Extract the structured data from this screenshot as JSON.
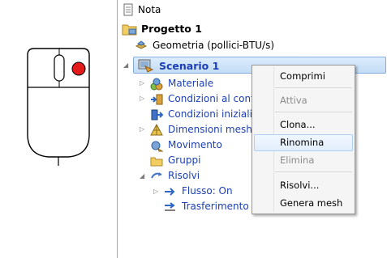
{
  "tree": {
    "nota": "Nota",
    "progetto": "Progetto 1",
    "geometria": "Geometria (pollici-BTU/s)",
    "scenario": "Scenario 1",
    "materiale": "Materiale",
    "condizioni_al_contorno": "Condizioni al cont",
    "condizioni_iniziali": "Condizioni iniziali",
    "dimensioni_mesh": "Dimensioni mesh",
    "movimento": "Movimento",
    "gruppi": "Gruppi",
    "risolvi": "Risolvi",
    "flusso": "Flusso: On",
    "trasferimento": "Trasferimento"
  },
  "context_menu": {
    "comprimi": "Comprimi",
    "attiva": "Attiva",
    "clona": "Clona...",
    "rinomina": "Rinomina",
    "elimina": "Elimina",
    "risolvi": "Risolvi...",
    "genera_mesh": "Genera mesh"
  },
  "colors": {
    "tree_link": "#1c3fb4",
    "selection": "#c3dcf5",
    "mouse_button": "#e31b1b"
  },
  "icons": [
    "mouse-right-click-icon",
    "note-icon",
    "project-folder-icon",
    "geometry-icon",
    "scenario-icon",
    "material-icon",
    "boundary-conditions-icon",
    "initial-conditions-icon",
    "mesh-size-icon",
    "motion-icon",
    "groups-icon",
    "solve-icon",
    "flow-icon",
    "transfer-icon"
  ]
}
